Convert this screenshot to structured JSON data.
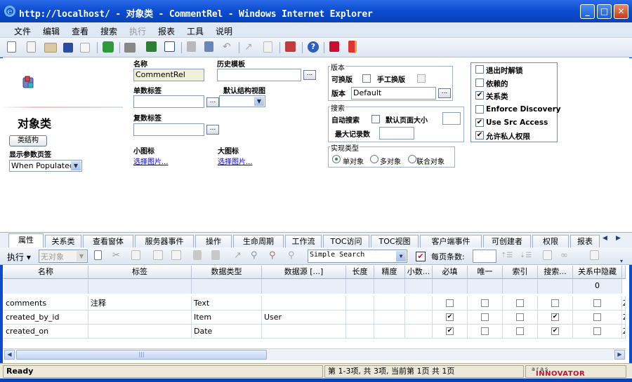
{
  "window": {
    "title": "http://localhost/ - 对象类 - CommentRel - Windows Internet Explorer",
    "minimize": "_",
    "maximize": "□",
    "close": "✕"
  },
  "menubar": {
    "items": [
      "文件",
      "编辑",
      "查看",
      "搜索",
      "执行",
      "报表",
      "工具",
      "说明"
    ],
    "disabled_item": "执行"
  },
  "toolbar": {
    "icons": [
      "new-icon",
      "copy-icon",
      "open-icon",
      "save-icon",
      "delete-icon",
      "refresh-icon",
      "print-icon",
      "excel-icon",
      "word-icon",
      "lock-icon",
      "unlock-icon",
      "undo-icon",
      "promote-icon",
      "revision-icon",
      "export-icon",
      "help-icon",
      "logout-icon",
      "exit-icon"
    ]
  },
  "form": {
    "page_title": "对象类",
    "class_structure_button": "类结构",
    "show_params_label": "显示参数页签",
    "show_params_value": "When Populated",
    "name_label": "名称",
    "name_value": "CommentRel",
    "history_template_label": "历史模板",
    "singular_label": "单数标签",
    "default_structure_view_label": "默认结构视图",
    "plural_label": "复数标签",
    "small_icon_label": "小图标",
    "small_icon_link": "选择图片...",
    "large_icon_label": "大图标",
    "large_icon_link": "选择图片...",
    "version_group": "版本",
    "versionable_label": "可换版",
    "manual_version_label": "手工换版",
    "version_label": "版本",
    "version_value": "Default",
    "search_group": "搜索",
    "auto_search_label": "自动搜索",
    "default_page_size_label": "默认页面大小",
    "max_records_label": "最大记录数",
    "implementation_group": "实现类型",
    "impl_options": [
      "单对象",
      "多对象",
      "联合对象"
    ],
    "impl_selected": "单对象",
    "options": [
      {
        "label": "退出时解锁",
        "checked": false
      },
      {
        "label": "依赖的",
        "checked": false
      },
      {
        "label": "关系类",
        "checked": true
      },
      {
        "label": "Enforce Discovery",
        "checked": false
      },
      {
        "label": "Use Src Access",
        "checked": true
      },
      {
        "label": "允许私人权限",
        "checked": true
      }
    ]
  },
  "tabs": {
    "items": [
      "属性",
      "关系类",
      "查看窗体",
      "服务器事件",
      "操作",
      "生命周期",
      "工作流",
      "TOC访问",
      "TOC视图",
      "客户端事件",
      "可创建者",
      "权限",
      "报表"
    ],
    "active": "属性"
  },
  "grid_toolbar": {
    "execute_label": "执行 ▾",
    "no_object_value": "无对象",
    "search_mode_value": "Simple Search",
    "page_size_label": "每页条数:"
  },
  "grid": {
    "columns": [
      "名称",
      "标签",
      "数据类型",
      "数据源 [...]",
      "长度",
      "精度",
      "小数...",
      "必填",
      "唯一",
      "索引",
      "搜索...",
      "关系中隐藏"
    ],
    "filter_row": [
      "",
      "",
      "",
      "",
      "",
      "",
      "",
      "",
      "",
      "",
      "",
      "0"
    ],
    "rows": [
      {
        "name": "comments",
        "label": "注释",
        "type": "Text",
        "source": "",
        "required": false,
        "unique": false,
        "indexed": false,
        "search": false,
        "hidden": false,
        "extra": "Z"
      },
      {
        "name": "created_by_id",
        "label": "",
        "type": "Item",
        "source": "User",
        "required": true,
        "unique": false,
        "indexed": false,
        "search": true,
        "hidden": false,
        "extra": "Z"
      },
      {
        "name": "created_on",
        "label": "",
        "type": "Date",
        "source": "",
        "required": true,
        "unique": false,
        "indexed": false,
        "search": true,
        "hidden": false,
        "extra": "Z"
      }
    ]
  },
  "status": {
    "ready": "Ready",
    "paging": "第 1-3项, 共 3项, 当前第 1页 共 1页",
    "brand_top": "aras",
    "brand_bottom": "INNOVATOR"
  },
  "colors": {
    "titlebar": "#0a4bd0",
    "menubar": "#dfe8f5",
    "filter_row": "#e8eff9",
    "brand_red": "#c8102e"
  }
}
